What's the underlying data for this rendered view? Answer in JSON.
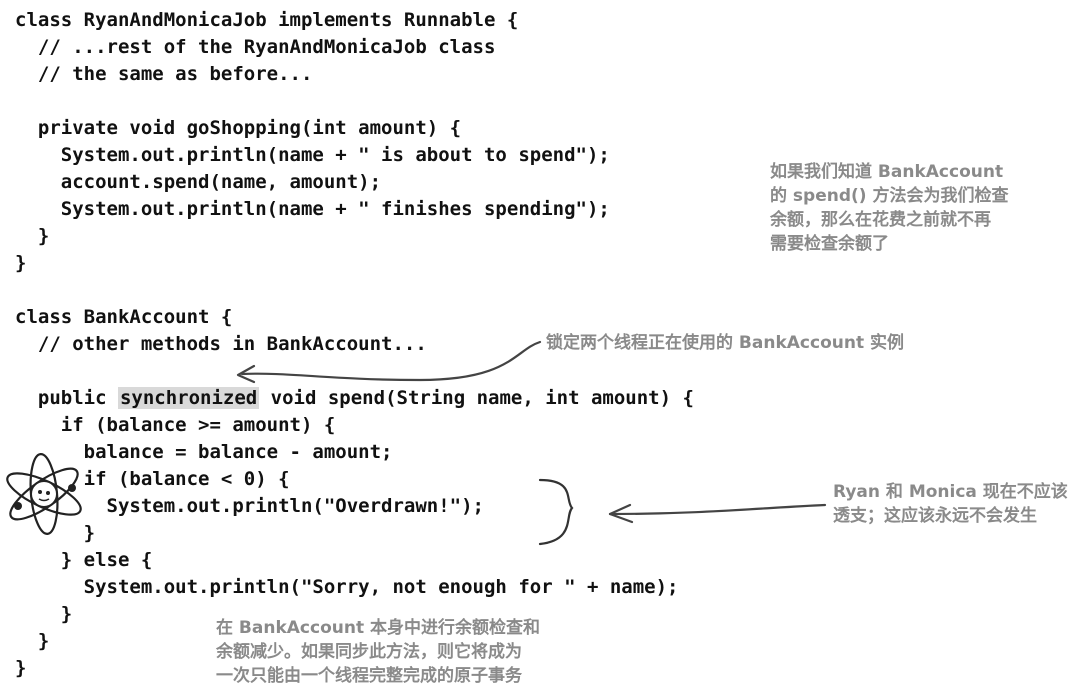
{
  "code": {
    "l1": "class RyanAndMonicaJob implements Runnable {",
    "l2": "  // ...rest of the RyanAndMonicaJob class",
    "l3": "  // the same as before...",
    "l5": "  private void goShopping(int amount) {",
    "l6": "    System.out.println(name + \" is about to spend\");",
    "l7": "    account.spend(name, amount);",
    "l8": "    System.out.println(name + \" finishes spending\");",
    "l9": "  }",
    "l10": "}",
    "l12": "class BankAccount {",
    "l13": "  // other methods in BankAccount...",
    "l15_pre": "  public ",
    "l15_kw": "synchronized",
    "l15_post": " void spend(String name, int amount) {",
    "l16": "    if (balance >= amount) {",
    "l17": "      balance = balance - amount;",
    "l18": "      if (balance < 0) {",
    "l19": "        System.out.println(\"Overdrawn!\");",
    "l20": "      }",
    "l21": "    } else {",
    "l22": "      System.out.println(\"Sorry, not enough for \" + name);",
    "l23": "    }",
    "l24": "  }",
    "l25": "}"
  },
  "notes": {
    "check_balance": [
      "如果我们知道 BankAccount",
      "的 spend() 方法会为我们检查",
      "余额，那么在花费之前就不再",
      "需要检查余额了"
    ],
    "lock": "锁定两个线程正在使用的 BankAccount 实例",
    "overdraw": [
      "Ryan 和 Monica 现在不应该",
      "透支；这应该永远不会发生"
    ],
    "atomic": [
      "在 BankAccount 本身中进行余额检查和",
      "余额减少。如果同步此方法，则它将成为",
      "一次只能由一个线程完整完成的原子事务"
    ]
  },
  "colors": {
    "code": "#111111",
    "annotation": "#8a8a8a",
    "highlight": "#d9d9d9"
  }
}
